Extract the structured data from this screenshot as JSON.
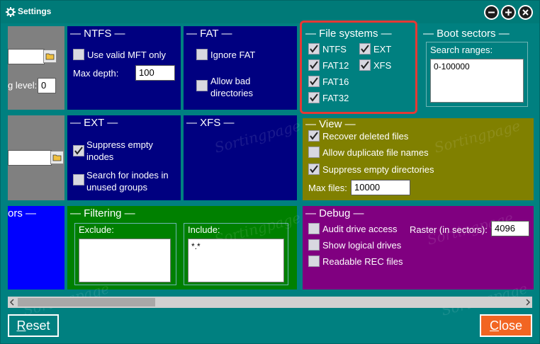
{
  "window": {
    "title": "Settings"
  },
  "watermark": "Sortingpage",
  "ntfs": {
    "title": "— NTFS —",
    "use_mft": "Use valid MFT only",
    "max_depth_label": "Max depth:",
    "max_depth_value": "100"
  },
  "fat": {
    "title": "— FAT —",
    "ignore_fat": "Ignore FAT",
    "allow_bad_1": "Allow bad",
    "allow_bad_2": "directories"
  },
  "file_systems": {
    "title": "— File systems —",
    "items": [
      "NTFS",
      "EXT",
      "FAT12",
      "XFS",
      "FAT16",
      "FAT32"
    ]
  },
  "boot_sectors": {
    "title": "— Boot sectors —",
    "search_label": "Search ranges:",
    "search_value": "0-100000"
  },
  "left_top": {
    "level_label": "g level:",
    "level_value": "0"
  },
  "ext": {
    "title": "— EXT —",
    "suppress_1": "Suppress empty",
    "suppress_2": "inodes",
    "search_1": "Search for inodes in",
    "search_2": "unused groups"
  },
  "xfs": {
    "title": "— XFS —"
  },
  "view": {
    "title": "— View —",
    "recover": "Recover deleted files",
    "allow_dup": "Allow duplicate file names",
    "suppress_dirs": "Suppress empty directories",
    "max_files_label": "Max files:",
    "max_files_value": "10000"
  },
  "left_bottom": {
    "title": "ors —"
  },
  "filtering": {
    "title": "— Filtering —",
    "exclude_label": "Exclude:",
    "include_label": "Include:",
    "include_value": "*.*"
  },
  "debug": {
    "title": "— Debug —",
    "audit": "Audit drive access",
    "raster_label": "Raster (in sectors):",
    "raster_value": "4096",
    "show_logical": "Show logical drives",
    "readable_rec": "Readable REC files"
  },
  "buttons": {
    "reset_first": "R",
    "reset_rest": "eset",
    "close_first": "C",
    "close_rest": "lose"
  }
}
